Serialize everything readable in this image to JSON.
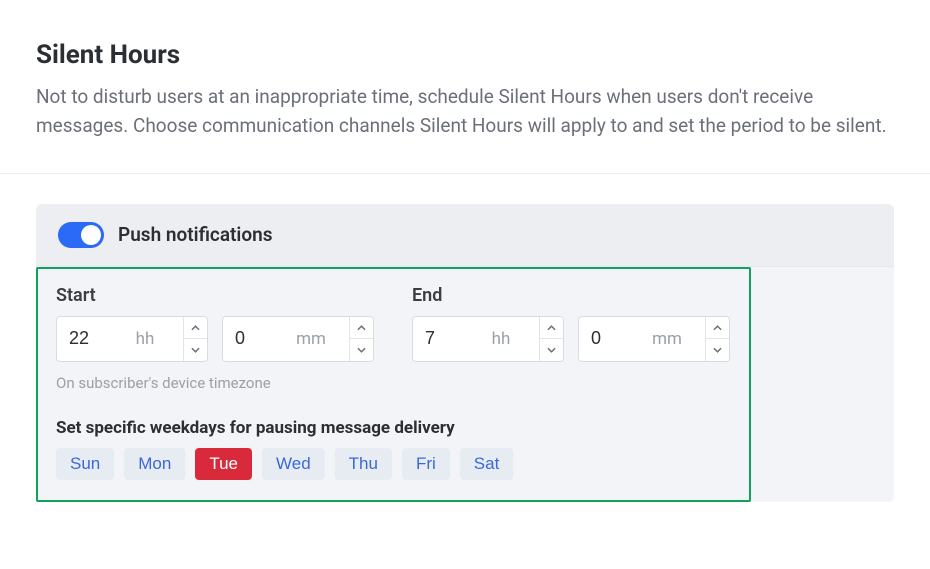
{
  "header": {
    "title": "Silent Hours",
    "description": "Not to disturb users at an inappropriate time, schedule Silent Hours when users don't receive messages. Choose communication channels Silent Hours will apply to and set the period to be silent."
  },
  "channel": {
    "label": "Push notifications",
    "enabled": true
  },
  "time": {
    "start_label": "Start",
    "end_label": "End",
    "unit_hh": "hh",
    "unit_mm": "mm",
    "start_hh": "22",
    "start_mm": "0",
    "end_hh": "7",
    "end_mm": "0",
    "tz_note": "On subscriber's device timezone"
  },
  "weekdays": {
    "label": "Set specific weekdays for pausing message delivery",
    "days": [
      "Sun",
      "Mon",
      "Tue",
      "Wed",
      "Thu",
      "Fri",
      "Sat"
    ],
    "selected": "Tue"
  }
}
